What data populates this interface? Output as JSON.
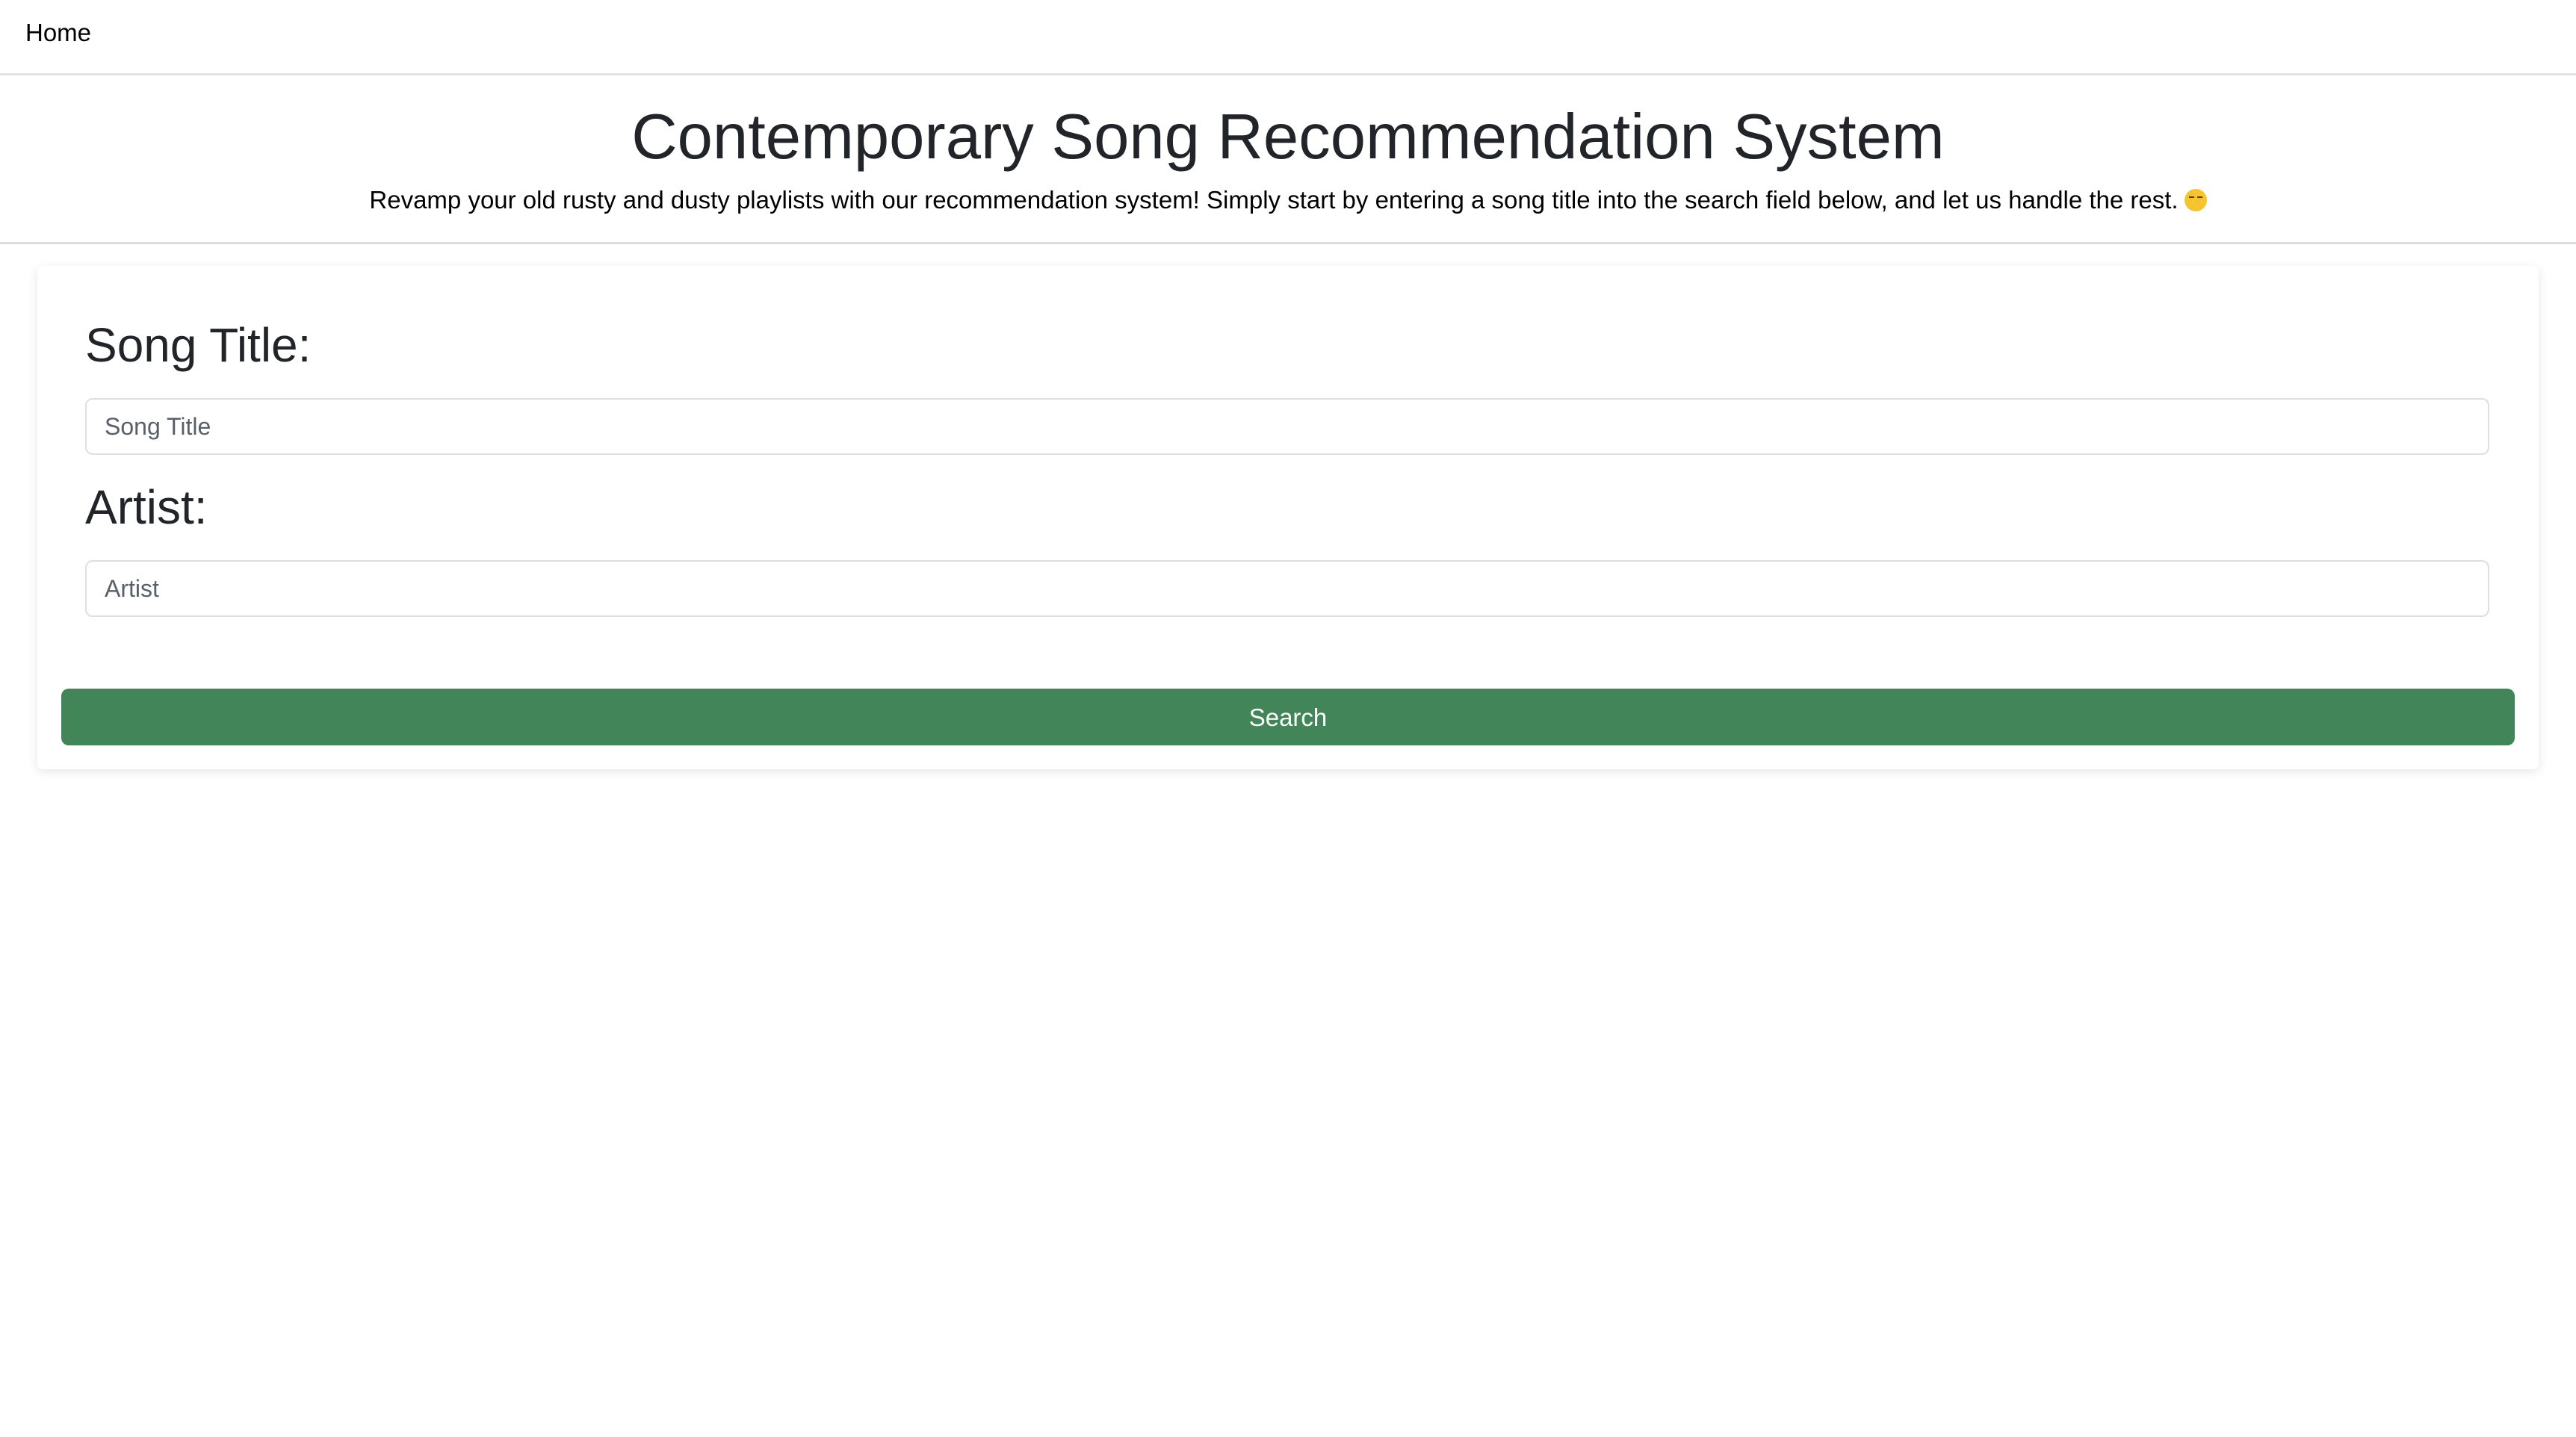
{
  "nav": {
    "home_label": "Home"
  },
  "header": {
    "title": "Contemporary Song Recommendation System",
    "subtitle": "Revamp your old rusty and dusty playlists with our recommendation system! Simply start by entering a song title into the search field below, and let us handle the rest.",
    "subtitle_emoji_icon": "smirking-face-emoji"
  },
  "form": {
    "song_title_label": "Song Title:",
    "song_title_placeholder": "Song Title",
    "artist_label": "Artist:",
    "artist_placeholder": "Artist",
    "search_label": "Search"
  },
  "colors": {
    "search_button": "#418558",
    "text": "#212529",
    "border": "#dcdfe3"
  }
}
